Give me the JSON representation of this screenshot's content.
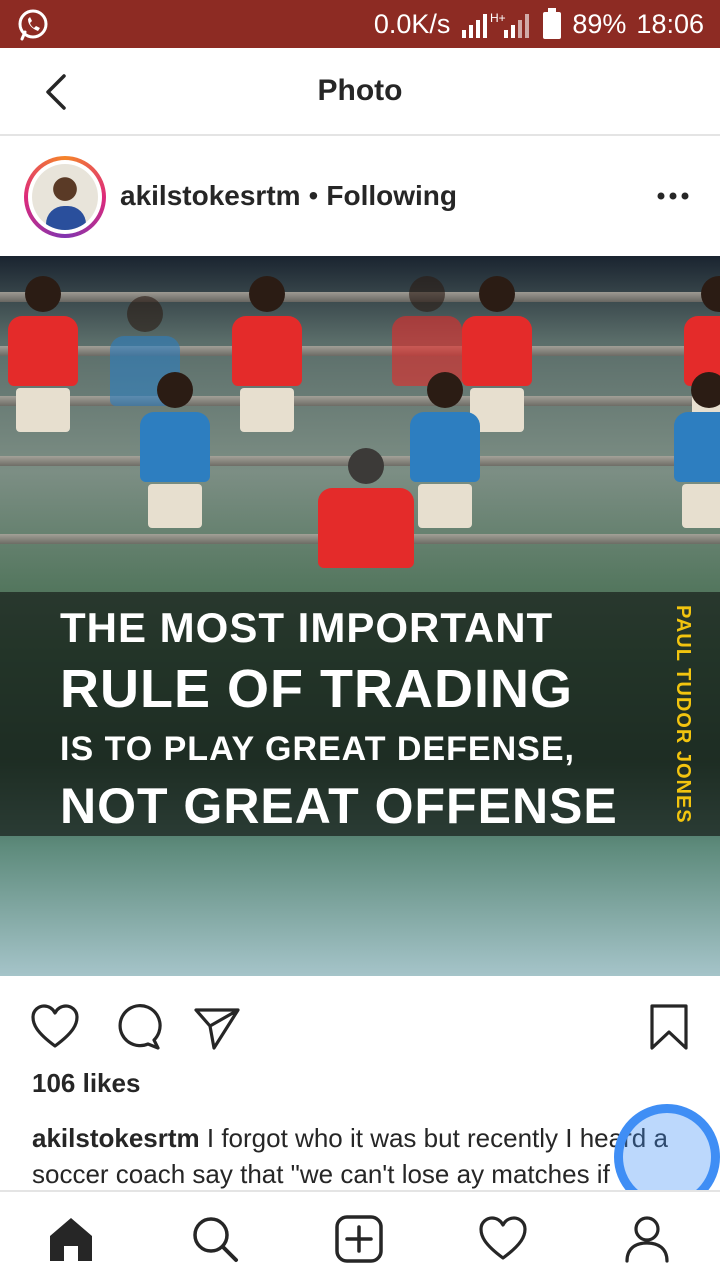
{
  "status_bar": {
    "app_icon": "whatsapp-icon",
    "net_speed": "0.0K/s",
    "signal_icon": "signal-icon",
    "battery_icon": "battery-icon",
    "battery": "89%",
    "time": "18:06",
    "color": "#8d2b23"
  },
  "header": {
    "back_icon": "back-icon",
    "title": "Photo"
  },
  "post": {
    "username": "akilstokesrtm",
    "separator": "•",
    "follow_status": "Following",
    "more_icon": "more-icon",
    "image": {
      "quote_line1": "THE MOST IMPORTANT",
      "quote_line2": "RULE OF TRADING",
      "quote_line3": "IS TO PLAY GREAT DEFENSE,",
      "quote_line4": "NOT GREAT OFFENSE",
      "author": "PAUL TUDOR JONES",
      "author_color": "#f2c40f"
    },
    "actions": {
      "like_icon": "heart-icon",
      "comment_icon": "comment-icon",
      "share_icon": "send-icon",
      "save_icon": "bookmark-icon"
    },
    "likes": "106 likes",
    "caption_user": "akilstokesrtm",
    "caption_text": "I forgot who it was but recently I heard a soccer coach say that \"we can't lose ay matches if"
  },
  "bottom_nav": [
    "home-icon",
    "search-icon",
    "add-icon",
    "activity-heart-icon",
    "profile-icon"
  ]
}
